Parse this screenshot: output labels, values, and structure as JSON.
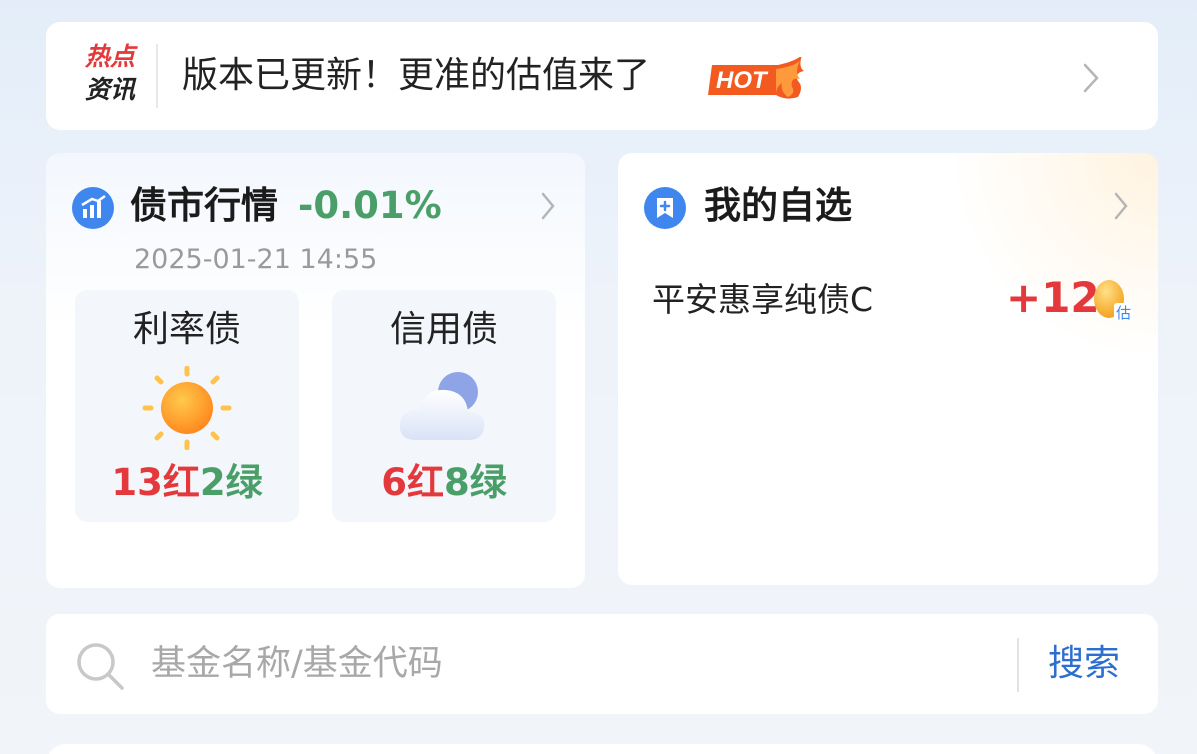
{
  "news": {
    "tag_line1": "热点",
    "tag_line2": "资讯",
    "headline": "版本已更新！更准的估值来了",
    "hot_badge": "HOT"
  },
  "bond_market": {
    "title": "债市行情",
    "change": "-0.01%",
    "timestamp": "2025-01-21 14:55",
    "rate_bond": {
      "label": "利率债",
      "weather": "sun-icon",
      "red_count": "13红",
      "green_count": "2绿"
    },
    "credit_bond": {
      "label": "信用债",
      "weather": "cloud-icon",
      "red_count": "6红",
      "green_count": "8绿"
    }
  },
  "watchlist": {
    "title": "我的自选",
    "items": [
      {
        "name": "平安惠享纯债C",
        "value": "+12",
        "badge": "估"
      }
    ]
  },
  "search": {
    "placeholder": "基金名称/基金代码",
    "button": "搜索"
  },
  "colors": {
    "red": "#e4393c",
    "green": "#4a9e68",
    "blue": "#2c6fd0"
  }
}
